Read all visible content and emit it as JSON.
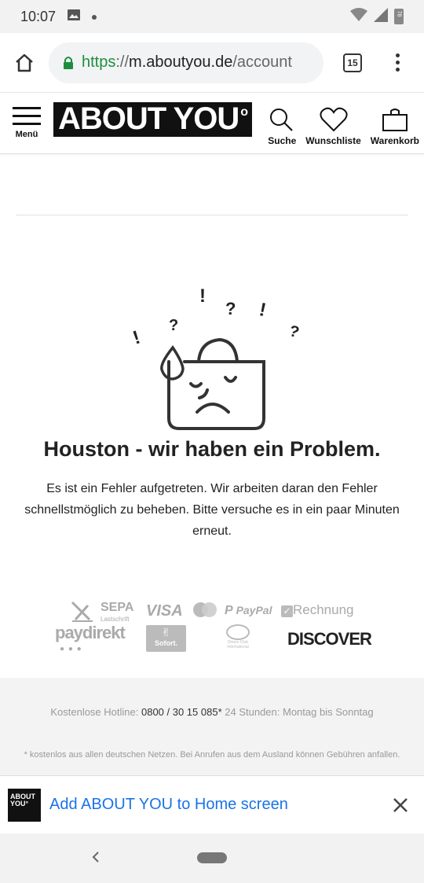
{
  "status_bar": {
    "time": "10:07",
    "battery": "78"
  },
  "browser": {
    "url_scheme": "https",
    "url_separator": "://",
    "url_host": "m.aboutyou.de",
    "url_path": "/account",
    "tab_count": "15"
  },
  "header": {
    "menu_label": "Menü",
    "logo_text": "ABOUT YOU",
    "search_label": "Suche",
    "wishlist_label": "Wunschliste",
    "cart_label": "Warenkorb"
  },
  "error": {
    "title": "Houston - wir haben ein Problem.",
    "text": "Es ist ein Fehler aufgetreten. Wir arbeiten daran den Fehler schnellstmöglich zu beheben. Bitte versuche es in ein paar Minuten erneut."
  },
  "payments": {
    "sepa": "SEPA",
    "sepa_sub": "Lastschrift",
    "visa": "VISA",
    "paypal": "PayPal",
    "invoice": "Rechnung",
    "paydirekt": "paydirekt",
    "sofort": "Sofort.",
    "diners": "Diners Club International",
    "discover": "DISCOVER"
  },
  "footer": {
    "hotline_label": "Kostenlose Hotline:",
    "hotline_number": "0800 / 30 15 085*",
    "hotline_hours": "24 Stunden: Montag bis Sonntag",
    "disclaimer": "* kostenlos aus allen deutschen Netzen. Bei Anrufen aus dem Ausland können Gebühren anfallen."
  },
  "a2hs": {
    "logo_line1": "ABOUT",
    "logo_line2": "YOU°",
    "text": "Add ABOUT YOU to Home screen"
  },
  "colors": {
    "secure_green": "#1e8e3e",
    "link_blue": "#1a73e8",
    "brand_black": "#111111",
    "footer_bg": "#f3f3f3"
  }
}
